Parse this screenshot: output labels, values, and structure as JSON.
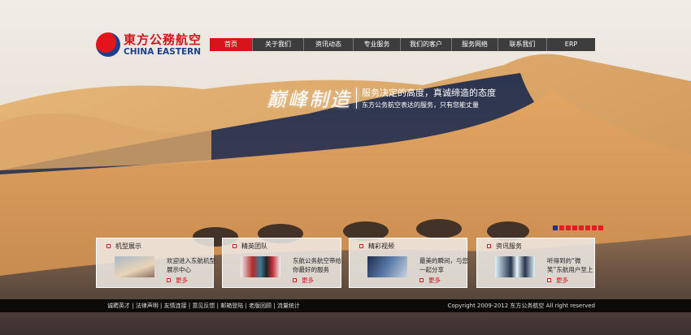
{
  "logo": {
    "cn": "東方公務航空",
    "en": "CHINA EASTERN"
  },
  "nav": [
    {
      "label": "首页",
      "active": true
    },
    {
      "label": "关于我们"
    },
    {
      "label": "资讯动态"
    },
    {
      "label": "专业服务"
    },
    {
      "label": "我们的客户"
    },
    {
      "label": "服务网络"
    },
    {
      "label": "联系我们"
    },
    {
      "label": "ERP"
    }
  ],
  "slogan": {
    "big": "巅峰制造",
    "line1": "服务决定的高度，真诚缔造的态度",
    "line2": "东方公务航空表达的服务，只有您能丈量"
  },
  "slider": {
    "count": 8,
    "active": 1
  },
  "cards": [
    {
      "title": "机型展示",
      "desc": "欢迎进入东航机型展示中心",
      "more": "更多"
    },
    {
      "title": "精英团队",
      "desc": "东航公务航空带给你最好的服务",
      "more": "更多"
    },
    {
      "title": "精彩视频",
      "desc": "最美的瞬间，与您一起分享",
      "more": "更多"
    },
    {
      "title": "资讯服务",
      "desc": "听得到的“微笑”东航用户至上",
      "more": "更多"
    }
  ],
  "footer": {
    "links": [
      "诚聘英才",
      "法律声明",
      "友情连接",
      "意见反馈",
      "邮箱登陆",
      "老版回顾",
      "流量统计"
    ],
    "copyright": "Copyright 2009-2012 东方公务航空 All right reserved"
  }
}
